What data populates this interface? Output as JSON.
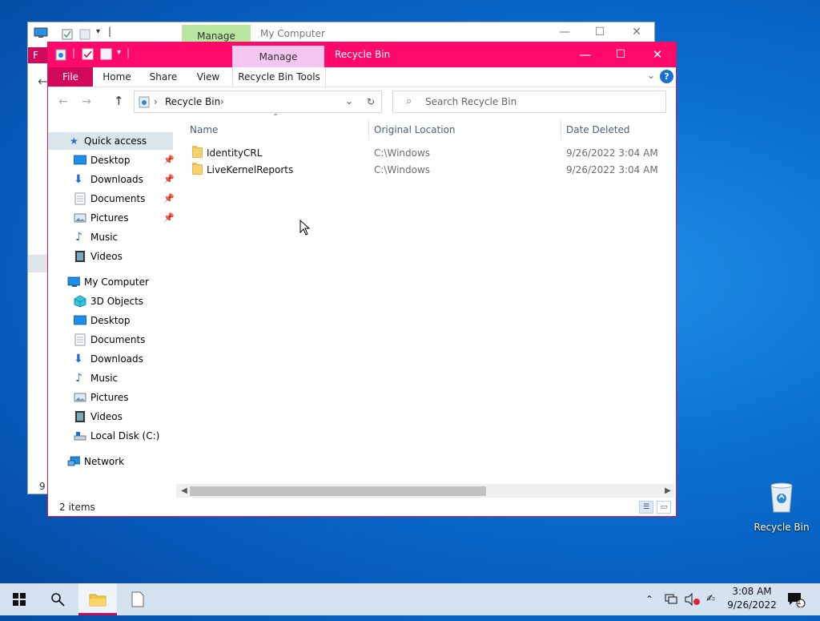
{
  "background_window": {
    "manage_tab": "Manage",
    "title": "My Computer",
    "partial_status": "9 i"
  },
  "window": {
    "title": "Recycle Bin",
    "context_tab": "Manage",
    "ribbon_tabs": [
      "File",
      "Home",
      "Share",
      "View",
      "Recycle Bin Tools"
    ],
    "help_label": "?",
    "address": {
      "crumb": "Recycle Bin"
    },
    "search_placeholder": "Search Recycle Bin",
    "nav": {
      "quick_access": "Quick access",
      "quick_items": [
        "Desktop",
        "Downloads",
        "Documents",
        "Pictures",
        "Music",
        "Videos"
      ],
      "my_computer": "My Computer",
      "computer_items": [
        "3D Objects",
        "Desktop",
        "Documents",
        "Downloads",
        "Music",
        "Pictures",
        "Videos",
        "Local Disk (C:)"
      ],
      "network": "Network"
    },
    "columns": [
      "Name",
      "Original Location",
      "Date Deleted"
    ],
    "rows": [
      {
        "name": "IdentityCRL",
        "location": "C:\\Windows",
        "date": "9/26/2022 3:04 AM"
      },
      {
        "name": "LiveKernelReports",
        "location": "C:\\Windows",
        "date": "9/26/2022 3:04 AM"
      }
    ],
    "status": "2 items"
  },
  "desktop": {
    "recycle_bin_label": "Recycle Bin"
  },
  "taskbar": {
    "time": "3:08 AM",
    "date": "9/26/2022",
    "notification_count": "1"
  },
  "colors": {
    "titlebar": "#ff0a6a",
    "file_tab": "#d1095c",
    "context_manage": "#f4c6f0",
    "bg_manage": "#b9e6a0",
    "taskbar": "#d5e3f1",
    "desktop": "#0a6fd0"
  }
}
